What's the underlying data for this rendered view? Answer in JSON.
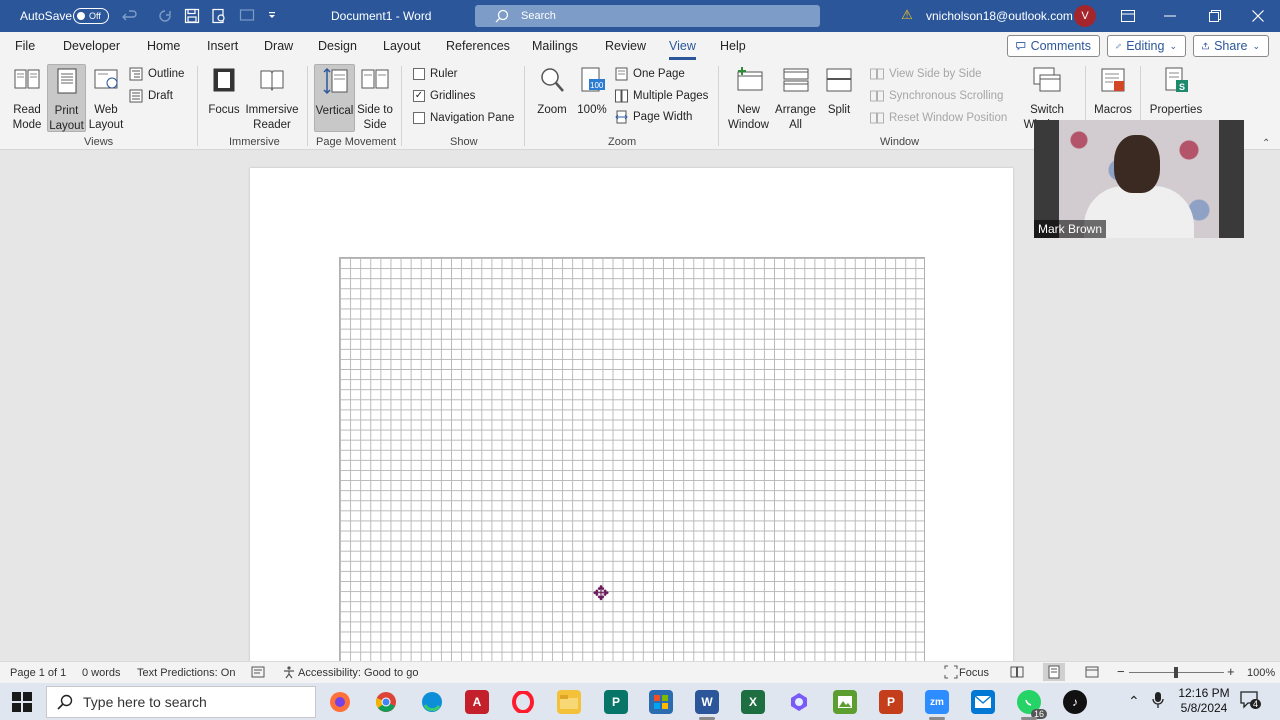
{
  "titlebar": {
    "autosave_label": "AutoSave",
    "autosave_state": "Off",
    "document_title": "Document1  -  Word",
    "search_placeholder": "Search",
    "account": "vnicholson18@outlook.com",
    "avatar_initial": "V"
  },
  "menu": {
    "tabs": [
      "File",
      "Developer",
      "Home",
      "Insert",
      "Draw",
      "Design",
      "Layout",
      "References",
      "Mailings",
      "Review",
      "View",
      "Help"
    ],
    "active_tab": "View",
    "comments_label": "Comments",
    "editing_label": "Editing",
    "share_label": "Share"
  },
  "ribbon": {
    "views": {
      "group_label": "Views",
      "read_mode": "Read Mode",
      "print_layout": "Print Layout",
      "web_layout": "Web Layout",
      "outline": "Outline",
      "draft": "Draft"
    },
    "immersive": {
      "group_label": "Immersive",
      "focus": "Focus",
      "immersive_reader": "Immersive Reader"
    },
    "page_movement": {
      "group_label": "Page Movement",
      "vertical": "Vertical",
      "side_to_side": "Side to Side"
    },
    "show": {
      "group_label": "Show",
      "ruler": "Ruler",
      "ruler_checked": false,
      "gridlines": "Gridlines",
      "gridlines_checked": true,
      "navigation_pane": "Navigation Pane",
      "navigation_pane_checked": false
    },
    "zoom": {
      "group_label": "Zoom",
      "zoom": "Zoom",
      "hundred": "100%",
      "one_page": "One Page",
      "multiple_pages": "Multiple Pages",
      "page_width": "Page Width"
    },
    "window": {
      "group_label": "Window",
      "new_window": "New Window",
      "arrange_all": "Arrange All",
      "split": "Split",
      "view_side_by_side": "View Side by Side",
      "synchronous_scrolling": "Synchronous Scrolling",
      "reset_window_position": "Reset Window Position",
      "switch_windows": "Switch Windows"
    },
    "macros": "Macros",
    "properties": "Properties"
  },
  "video": {
    "participant_name": "Mark Brown"
  },
  "statusbar": {
    "page": "Page 1 of 1",
    "words": "0 words",
    "text_predictions": "Text Predictions: On",
    "accessibility": "Accessibility: Good to go",
    "focus": "Focus",
    "zoom_percent": "100%"
  },
  "taskbar": {
    "search_placeholder": "Type here to search",
    "time": "12:16 PM",
    "date": "5/8/2024",
    "whatsapp_badge": "16",
    "notification_count": "4"
  },
  "colors": {
    "word_blue": "#2b579a",
    "ribbon_bg": "#f3f3f3",
    "canvas_bg": "#e6e6e6"
  }
}
